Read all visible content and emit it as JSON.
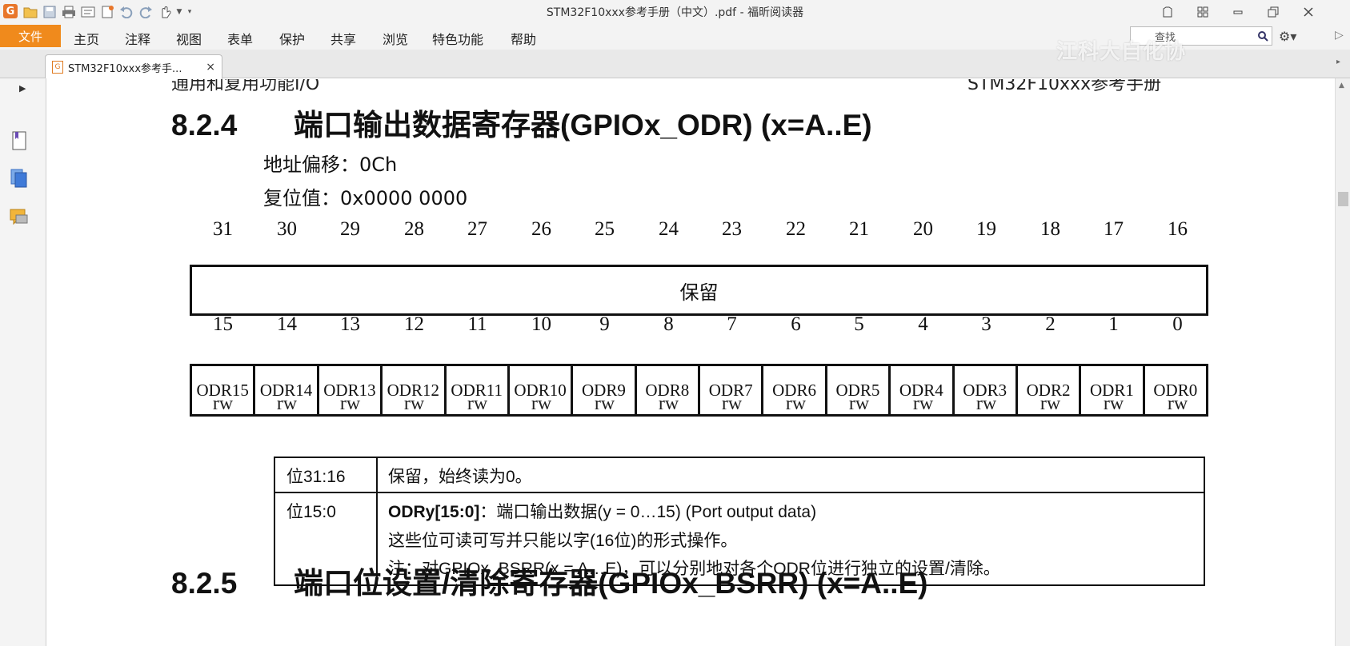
{
  "window": {
    "title": "STM32F10xxx参考手册（中文）.pdf - 福昕阅读器"
  },
  "menu": {
    "file": "文件",
    "items": [
      "主页",
      "注释",
      "视图",
      "表单",
      "保护",
      "共享",
      "浏览",
      "特色功能",
      "帮助"
    ]
  },
  "search": {
    "placeholder": "查找"
  },
  "watermark": "江科大自化协",
  "tab": {
    "label": "STM32F10xxx参考手...",
    "close": "×"
  },
  "document": {
    "header_left": "通用和复用功能I/O",
    "header_right": "STM32F10xxx参考手册",
    "section1": {
      "number": "8.2.4",
      "title": "端口输出数据寄存器(GPIOx_ODR) (x=A..E)",
      "address_offset": "地址偏移：0Ch",
      "reset_value": "复位值：0x0000 0000"
    },
    "register": {
      "high_bits": [
        "31",
        "30",
        "29",
        "28",
        "27",
        "26",
        "25",
        "24",
        "23",
        "22",
        "21",
        "20",
        "19",
        "18",
        "17",
        "16"
      ],
      "reserved_label": "保留",
      "low_bits": [
        "15",
        "14",
        "13",
        "12",
        "11",
        "10",
        "9",
        "8",
        "7",
        "6",
        "5",
        "4",
        "3",
        "2",
        "1",
        "0"
      ],
      "fields": [
        "ODR15",
        "ODR14",
        "ODR13",
        "ODR12",
        "ODR11",
        "ODR10",
        "ODR9",
        "ODR8",
        "ODR7",
        "ODR6",
        "ODR5",
        "ODR4",
        "ODR3",
        "ODR2",
        "ODR1",
        "ODR0"
      ],
      "access": [
        "rw",
        "rw",
        "rw",
        "rw",
        "rw",
        "rw",
        "rw",
        "rw",
        "rw",
        "rw",
        "rw",
        "rw",
        "rw",
        "rw",
        "rw",
        "rw"
      ]
    },
    "description": {
      "row1": {
        "bits": "位31:16",
        "text": "保留，始终读为0。"
      },
      "row2": {
        "bits": "位15:0",
        "field_name": "ODRy[15:0]",
        "line1_rest": "：端口输出数据(y = 0…15) (Port output data)",
        "line2": "这些位可读可写并只能以字(16位)的形式操作。",
        "line3": "注：对GPIOx_BSRR(x = A…E)，可以分别地对各个ODR位进行独立的设置/清除。"
      }
    },
    "section2": {
      "number": "8.2.5",
      "title": "端口位设置/清除寄存器(GPIOx_BSRR) (x=A..E)"
    }
  }
}
